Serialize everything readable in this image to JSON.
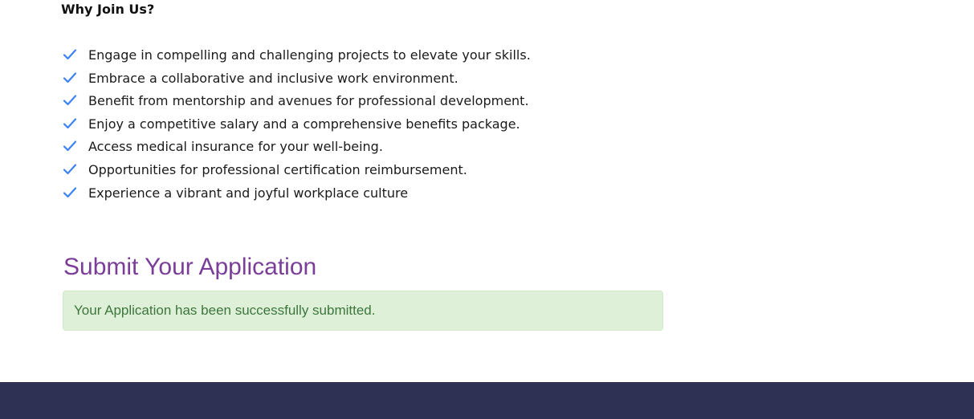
{
  "why_join": {
    "heading": "Why Join Us?",
    "items": [
      "Engage in compelling and challenging projects to elevate your skills.",
      "Embrace a collaborative and inclusive work environment.",
      "Benefit from mentorship and avenues for professional development.",
      "Enjoy a competitive salary and a comprehensive benefits package.",
      "Access medical insurance for your well-being.",
      "Opportunities for professional certification reimbursement.",
      "Experience a vibrant and joyful workplace culture"
    ],
    "icon": "check-icon"
  },
  "application": {
    "title": "Submit Your Application",
    "success_message": "Your Application has been successfully submitted."
  },
  "colors": {
    "check": "#3b82f6",
    "title": "#7a3e98",
    "alert_bg": "#dff0d8",
    "alert_text": "#3c763d",
    "footer_bg": "#2e3153"
  }
}
